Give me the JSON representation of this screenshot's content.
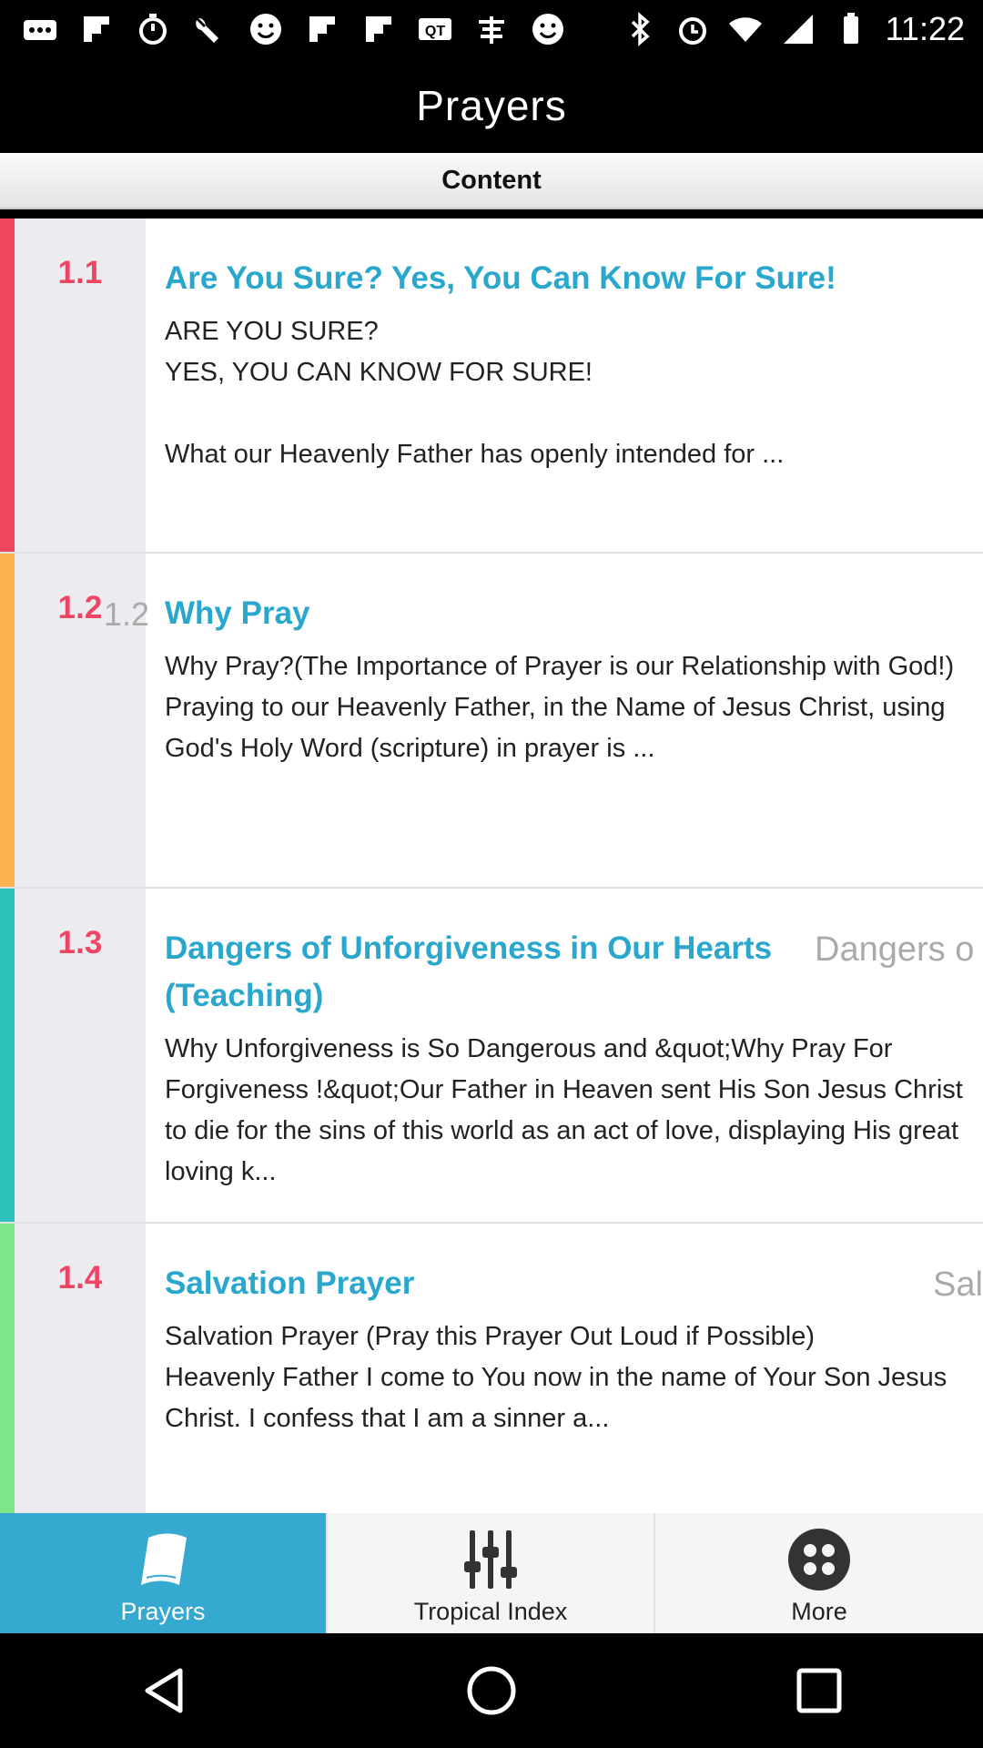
{
  "status_bar": {
    "time": "11:22",
    "left_icons": [
      "more-dots-icon",
      "flipboard-icon",
      "timer-icon",
      "wrench-icon",
      "smiley-icon",
      "flipboard-icon",
      "flipboard-icon",
      "qt-icon",
      "jp-icon",
      "smiley-icon"
    ],
    "right_icons": [
      "bluetooth-icon",
      "alarm-icon",
      "wifi-icon",
      "signal-icon",
      "battery-icon"
    ]
  },
  "header": {
    "title": "Prayers"
  },
  "content_bar": {
    "label": "Content"
  },
  "items": [
    {
      "number": "1.1",
      "ghost_number": "",
      "title": "Are You Sure? Yes, You Can Know For Sure!",
      "ghost_title": "",
      "body": "ARE YOU SURE?\nYES, YOU CAN KNOW FOR SURE!\n\nWhat our Heavenly Father has openly intended for ...",
      "color": "#f0455f"
    },
    {
      "number": "1.2",
      "ghost_number": "1.2",
      "title": "Why Pray",
      "ghost_title": "",
      "body": "Why Pray?(The Importance of Prayer is our Relationship with God!)\nPraying to our Heavenly Father, in the Name of Jesus Christ, using God's Holy Word (scripture) in prayer is ...",
      "color": "#fbb150"
    },
    {
      "number": "1.3",
      "ghost_number": "",
      "title": "Dangers of Unforgiveness in Our Hearts (Teaching)",
      "ghost_title": "Dangers o",
      "body": "Why Unforgiveness is So Dangerous and &quot;Why Pray For Forgiveness !&quot;Our Father in Heaven sent His Son Jesus Christ to die for the sins of this world as an act of love, displaying His great loving k...",
      "color": "#2fc2bd"
    },
    {
      "number": "1.4",
      "ghost_number": "",
      "title": "Salvation Prayer",
      "ghost_title": "Sal",
      "body": "Salvation Prayer    (Pray this Prayer Out Loud if Possible)\nHeavenly Father I come to You now in the name of Your Son Jesus Christ.  I confess that I am a sinner a...",
      "color": "#7ee58a"
    }
  ],
  "tabs": [
    {
      "label": "Prayers",
      "icon": "book-icon",
      "active": true
    },
    {
      "label": "Tropical Index",
      "icon": "sliders-icon",
      "active": false
    },
    {
      "label": "More",
      "icon": "grid-dots-icon",
      "active": false
    }
  ],
  "nav": [
    "back-icon",
    "home-icon",
    "recents-icon"
  ]
}
